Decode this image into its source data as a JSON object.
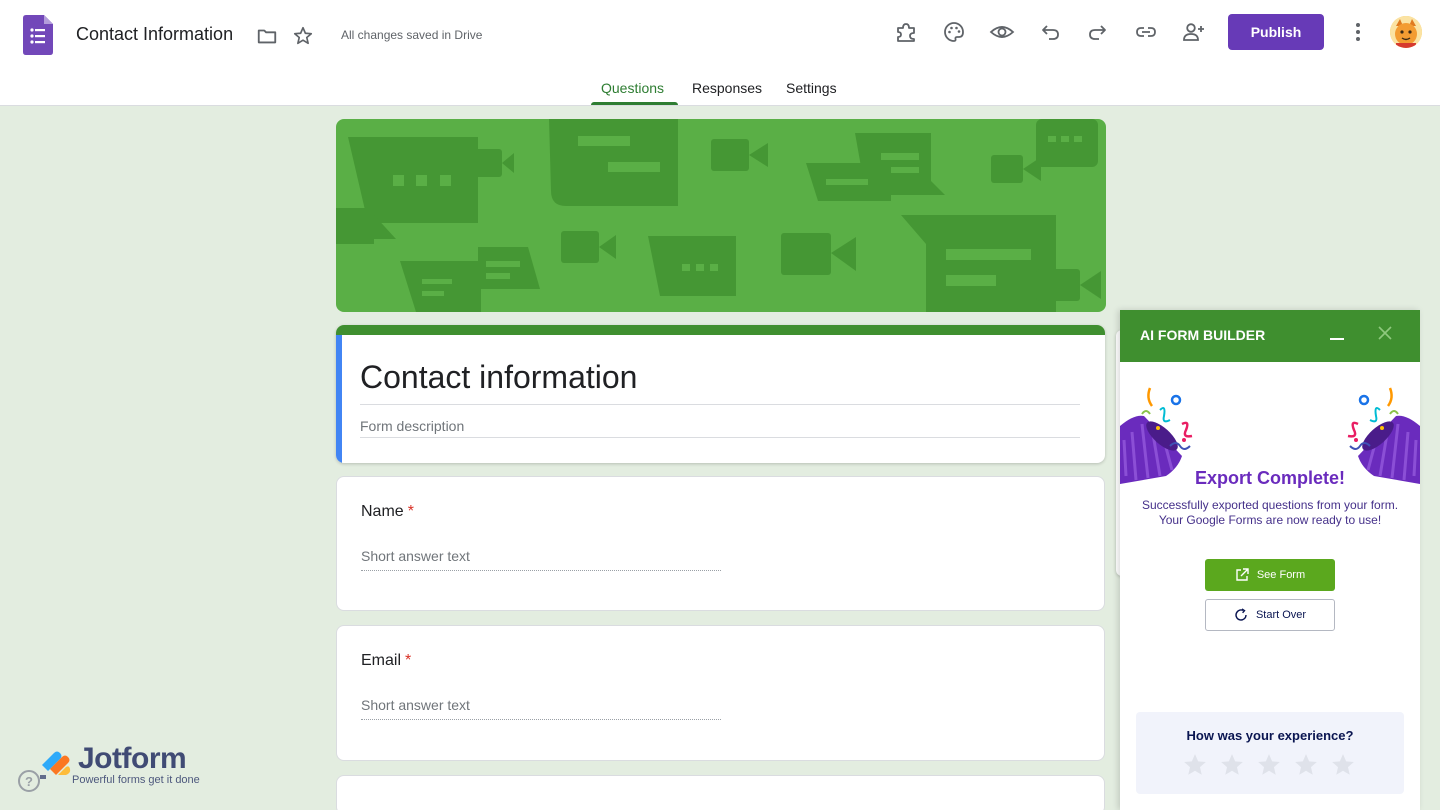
{
  "header": {
    "doc_title": "Contact Information",
    "saved_status": "All changes saved in Drive",
    "publish_label": "Publish",
    "icons": [
      "folder-icon",
      "star-icon",
      "addon-icon",
      "palette-icon",
      "preview-icon",
      "undo-icon",
      "redo-icon",
      "link-icon",
      "add-collaborator-icon",
      "more-vert-icon"
    ]
  },
  "tabs": [
    {
      "label": "Questions",
      "active": true
    },
    {
      "label": "Responses",
      "active": false
    },
    {
      "label": "Settings",
      "active": false
    }
  ],
  "form": {
    "title": "Contact information",
    "description_placeholder": "Form description",
    "questions": [
      {
        "label": "Name",
        "required_mark": "*",
        "hint": "Short answer text"
      },
      {
        "label": "Email",
        "required_mark": "*",
        "hint": "Short answer text"
      }
    ]
  },
  "watermark": {
    "brand": "Jotform",
    "tagline": "Powerful forms get it done",
    "help": "?"
  },
  "panel": {
    "title": "AI FORM BUILDER",
    "export_title": "Export Complete!",
    "export_line1": "Successfully exported questions from your form.",
    "export_line2": "Your Google Forms are now ready to use!",
    "see_form_label": "See Form",
    "start_over_label": "Start Over",
    "feedback_question": "How was your experience?",
    "rating": {
      "value": 0,
      "max": 5
    }
  },
  "colors": {
    "brand_purple": "#673ab7",
    "theme_green": "#3f8f2f",
    "banner_green": "#5aaf46",
    "page_bg": "#e3ede0",
    "accent_blue": "#4285f4",
    "required_red": "#d93025"
  }
}
